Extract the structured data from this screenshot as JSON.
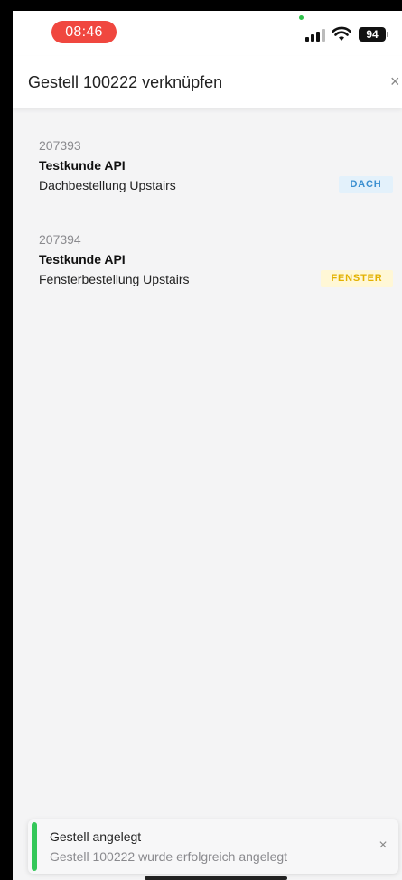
{
  "status_bar": {
    "time": "08:46",
    "battery": "94",
    "icons": [
      "signal-icon",
      "wifi-icon",
      "battery-icon"
    ]
  },
  "modal": {
    "title": "Gestell 100222 verknüpfen",
    "close_icon": "×"
  },
  "orders": [
    {
      "number": "207393",
      "customer": "Testkunde API",
      "description": "Dachbestellung Upstairs",
      "badge": "DACH",
      "badge_color": "#3b8fd0",
      "badge_bg": "#e3f1fb"
    },
    {
      "number": "207394",
      "customer": "Testkunde API",
      "description": "Fensterbestellung Upstairs",
      "badge": "FENSTER",
      "badge_color": "#e3b100",
      "badge_bg": "#fff7d6"
    }
  ],
  "toast": {
    "title": "Gestell angelegt",
    "message": "Gestell 100222 wurde erfolgreich angelegt",
    "close_icon": "×",
    "accent": "#34c759"
  },
  "colors": {
    "time_pill": "#f0473f",
    "background": "#f4f4f5"
  }
}
